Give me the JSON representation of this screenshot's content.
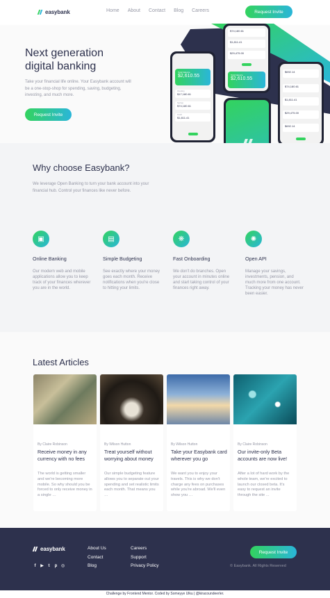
{
  "brand": {
    "name": "easybank"
  },
  "nav": [
    "Home",
    "About",
    "Contact",
    "Blog",
    "Careers"
  ],
  "cta_label": "Request Invite",
  "hero": {
    "title_line1": "Next generation",
    "title_line2": "digital banking",
    "text": "Take your financial life online. Your Easybank account will be a one-stop-shop for spending, saving, budgeting, investing, and much more."
  },
  "phones": {
    "balance": "$2,610.55",
    "rows": [
      "$74,180.61",
      "$1,811.41",
      "$29,475.00",
      "$692.14",
      "$17,180.61"
    ]
  },
  "why": {
    "title": "Why choose Easybank?",
    "text": "We leverage Open Banking to turn your bank account into your financial hub. Control your finances like never before.",
    "features": [
      {
        "icon": "online-banking-icon",
        "glyph": "▣",
        "title": "Online Banking",
        "text": "Our modern web and mobile applications allow you to keep track of your finances wherever you are in the world."
      },
      {
        "icon": "budgeting-icon",
        "glyph": "▤",
        "title": "Simple Budgeting",
        "text": "See exactly where your money goes each month. Receive notifications when you're close to hitting your limits."
      },
      {
        "icon": "onboarding-icon",
        "glyph": "❋",
        "title": "Fast Onboarding",
        "text": "We don't do branches. Open your account in minutes online and start taking control of your finances right away."
      },
      {
        "icon": "api-icon",
        "glyph": "✺",
        "title": "Open API",
        "text": "Manage your savings, investments, pension, and much more from one account. Tracking your money has never been easier."
      }
    ]
  },
  "articles": {
    "title": "Latest Articles",
    "items": [
      {
        "author": "By Claire Robinson",
        "title": "Receive money in any currency with no fees",
        "text": "The world is getting smaller and we're becoming more mobile. So why should you be forced to only receive money in a single …",
        "image": "currency-notes-image"
      },
      {
        "author": "By Wilson Hutton",
        "title": "Treat yourself without worrying about money",
        "text": "Our simple budgeting feature allows you to separate out your spending and set realistic limits each month. That means you …",
        "image": "restaurant-image"
      },
      {
        "author": "By Wilson Hutton",
        "title": "Take your Easybank card wherever you go",
        "text": "We want you to enjoy your travels. This is why we don't charge any fees on purchases while you're abroad. We'll even show you …",
        "image": "airplane-image"
      },
      {
        "author": "By Claire Robinson",
        "title": "Our invite-only Beta accounts are now live!",
        "text": "After a lot of hard work by the whole team, we're excited to launch our closed beta. It's easy to request an invite through the site ...",
        "image": "confetti-image"
      }
    ]
  },
  "footer": {
    "col1": [
      "About Us",
      "Contact",
      "Blog"
    ],
    "col2": [
      "Careers",
      "Support",
      "Privacy Policy"
    ],
    "social": [
      "facebook-icon",
      "youtube-icon",
      "twitter-icon",
      "pinterest-icon",
      "instagram-icon"
    ],
    "copyright": "© Easybank. All Rights Reserved",
    "attribution": "Challenge by Frontend Mentor. Coded by Someyye Ulku | @kiracoundeerler."
  },
  "colors": {
    "accent_green": "#33d35e",
    "accent_cyan": "#2ab6d9",
    "navy": "#2d314d",
    "gray": "#9698a6"
  }
}
